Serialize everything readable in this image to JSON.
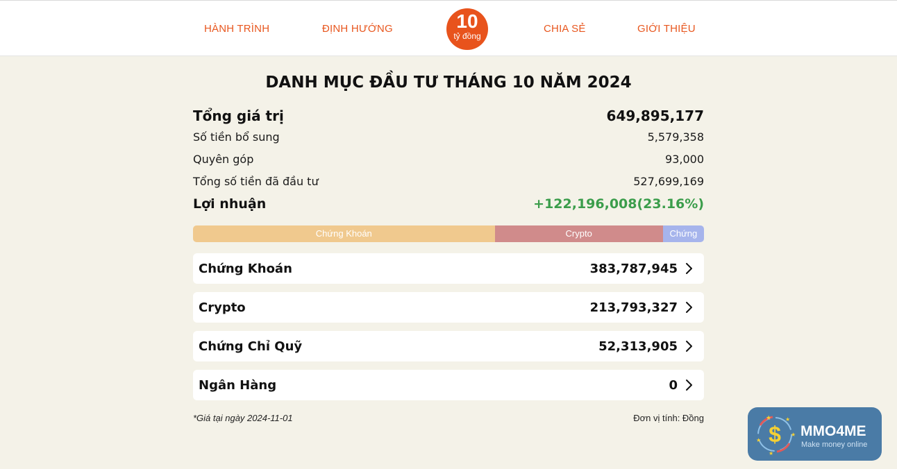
{
  "nav": {
    "links": [
      "HÀNH TRÌNH",
      "ĐỊNH HƯỚNG",
      "CHIA SẺ",
      "GIỚI THIỆU"
    ],
    "logo": {
      "number": "10",
      "subtitle": "tỷ đồng",
      "color": "#e8531c"
    }
  },
  "title": "DANH MỤC ĐẦU TƯ THÁNG 10 NĂM 2024",
  "summary": {
    "total": {
      "label": "Tổng giá trị",
      "value": "649,895,177"
    },
    "additional": {
      "label": "Số tiền bổ sung",
      "value": "5,579,358"
    },
    "donation": {
      "label": "Quyên góp",
      "value": "93,000"
    },
    "invested": {
      "label": "Tổng số tiền đã đầu tư",
      "value": "527,699,169"
    },
    "profit": {
      "label": "Lợi nhuận",
      "value": "+122,196,008(23.16%)",
      "color": "#3b9d4b"
    }
  },
  "allocation": [
    {
      "label": "Chứng Khoán",
      "fraction": 0.5905,
      "color": "#f0c98e"
    },
    {
      "label": "Crypto",
      "fraction": 0.329,
      "color": "#d08b8b"
    },
    {
      "label": "Chứng",
      "fraction": 0.0805,
      "color": "#a6b4ec"
    }
  ],
  "assets": [
    {
      "name": "Chứng Khoán",
      "value": "383,787,945"
    },
    {
      "name": "Crypto",
      "value": "213,793,327"
    },
    {
      "name": "Chứng Chỉ Quỹ",
      "value": "52,313,905"
    },
    {
      "name": "Ngân Hàng",
      "value": "0"
    }
  ],
  "footer": {
    "price_note": "*Giá tại ngày 2024-11-01",
    "unit": "Đơn vị tính: Đồng"
  },
  "badge": {
    "name": "MMO4ME",
    "tagline": "Make money online",
    "icon": "dollar-coin-icon"
  }
}
